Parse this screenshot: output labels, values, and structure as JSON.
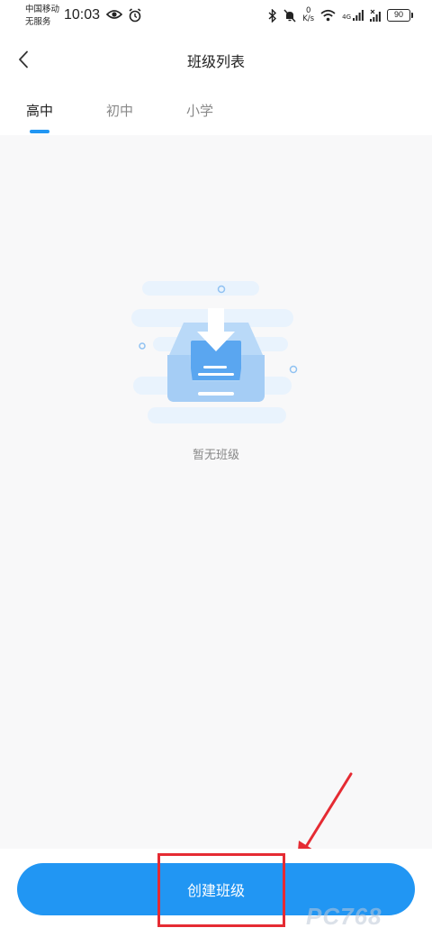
{
  "status_bar": {
    "carrier_line1": "中国移动",
    "carrier_line2": "无服务",
    "time": "10:03",
    "net_speed_value": "0",
    "net_speed_unit": "K/s",
    "network_type": "4G",
    "battery": "90"
  },
  "nav": {
    "title": "班级列表"
  },
  "tabs": [
    {
      "label": "高中",
      "active": true
    },
    {
      "label": "初中",
      "active": false
    },
    {
      "label": "小学",
      "active": false
    }
  ],
  "empty_state": {
    "message": "暂无班级"
  },
  "actions": {
    "create_class_label": "创建班级"
  },
  "watermark": "PC768",
  "colors": {
    "accent": "#2196f3",
    "annotation": "#e52b33",
    "background": "#f8f8f9"
  }
}
